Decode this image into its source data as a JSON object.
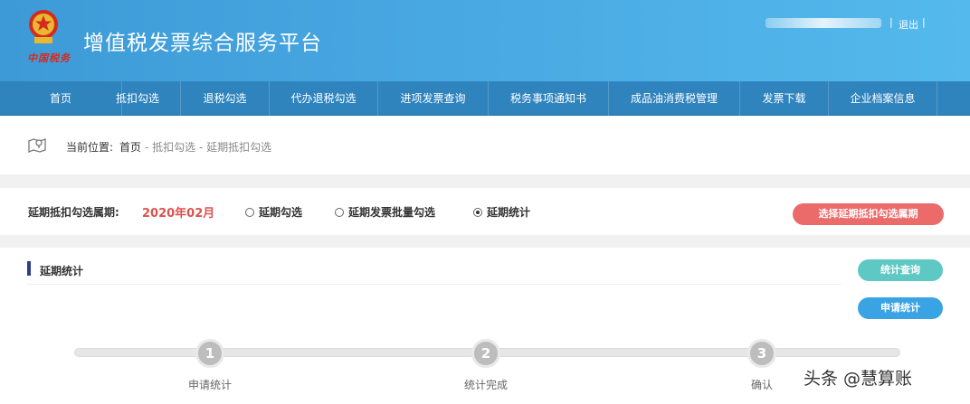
{
  "header": {
    "emblem_text": "中国税务",
    "title": "增值税发票综合服务平台",
    "separator": "|",
    "logout": "退出"
  },
  "nav": {
    "items": [
      {
        "label": "首页"
      },
      {
        "label": "抵扣勾选"
      },
      {
        "label": "退税勾选"
      },
      {
        "label": "代办退税勾选"
      },
      {
        "label": "进项发票查询"
      },
      {
        "label": "税务事项通知书"
      },
      {
        "label": "成品油消费税管理"
      },
      {
        "label": "发票下载"
      },
      {
        "label": "企业档案信息"
      }
    ]
  },
  "breadcrumb": {
    "label": "当前位置:",
    "home": "首页",
    "rest": "- 抵扣勾选 - 延期抵扣勾选"
  },
  "period": {
    "label": "延期抵扣勾选属期:",
    "value": "2020年02月",
    "options": [
      {
        "label": "延期勾选",
        "selected": false
      },
      {
        "label": "延期发票批量勾选",
        "selected": false
      },
      {
        "label": "延期统计",
        "selected": true
      }
    ],
    "select_button": "选择延期抵扣勾选属期"
  },
  "panel": {
    "title": "延期统计",
    "query_button": "统计查询",
    "apply_button": "申请统计"
  },
  "steps": [
    {
      "number": "1",
      "label": "申请统计"
    },
    {
      "number": "2",
      "label": "统计完成"
    },
    {
      "number": "3",
      "label": "确认"
    }
  ],
  "watermark": "头条 @慧算账",
  "colors": {
    "header_blue": "#48a8e2",
    "nav_blue": "#2f84be",
    "accent_red": "#eb6b6b",
    "period_red": "#d9534f",
    "teal": "#5ec8c4",
    "button_blue": "#3aa3e3",
    "step_gray": "#bdbdbd"
  }
}
